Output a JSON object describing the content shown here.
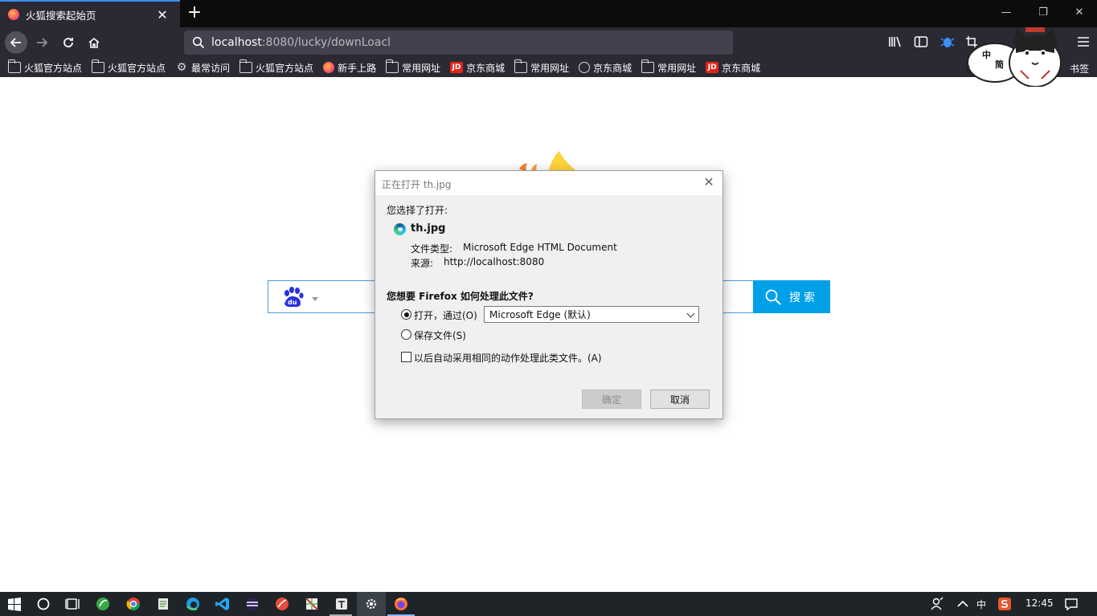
{
  "browser": {
    "tab_title": "火狐搜索起始页",
    "tab_close": "✕",
    "new_tab": "+",
    "url_host": "localhost",
    "url_rest": ":8080/lucky/downLoacl",
    "window": {
      "minimize": "—",
      "restore": "❐",
      "close": "✕"
    }
  },
  "bookmarks": [
    {
      "label": "火狐官方站点",
      "icon": "folder-icon"
    },
    {
      "label": "火狐官方站点",
      "icon": "folder-icon"
    },
    {
      "label": "最常访问",
      "icon": "gear-icon"
    },
    {
      "label": "火狐官方站点",
      "icon": "folder-icon"
    },
    {
      "label": "新手上路",
      "icon": "firefox-icon"
    },
    {
      "label": "常用网址",
      "icon": "folder-icon"
    },
    {
      "label": "京东商城",
      "icon": "jd-icon"
    },
    {
      "label": "常用网址",
      "icon": "folder-icon"
    },
    {
      "label": "京东商城",
      "icon": "globe-icon"
    },
    {
      "label": "常用网址",
      "icon": "folder-icon"
    },
    {
      "label": "京东商城",
      "icon": "jd-icon"
    }
  ],
  "bookmarks_right": "书签",
  "jd_text": "JD",
  "sticker": {
    "char1": "中",
    "char2": "简"
  },
  "page": {
    "search_button": "搜索"
  },
  "dialog": {
    "title": "正在打开 th.jpg",
    "close": "✕",
    "intro": "您选择了打开:",
    "filename": "th.jpg",
    "type_label": "文件类型:",
    "type_value": "Microsoft Edge HTML Document",
    "source_label": "来源:",
    "source_value": "http://localhost:8080",
    "question": "您想要 Firefox 如何处理此文件?",
    "open_with_label": "打开，通过(O)",
    "open_with_value": "Microsoft Edge (默认)",
    "save_label": "保存文件(S)",
    "auto_label": "以后自动采用相同的动作处理此类文件。(A)",
    "ok": "确定",
    "cancel": "取消"
  },
  "taskbar": {
    "ime": "中",
    "clock": "12:45"
  }
}
